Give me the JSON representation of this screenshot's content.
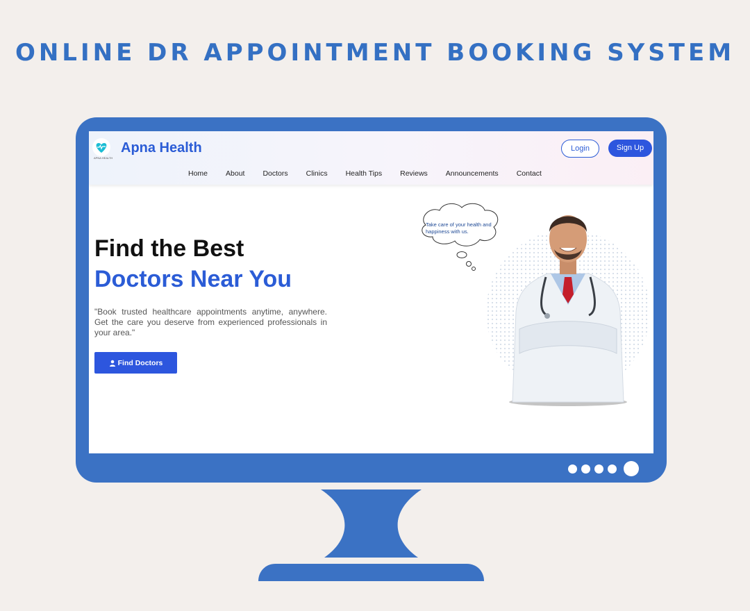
{
  "page": {
    "title": "ONLINE DR APPOINTMENT BOOKING SYSTEM"
  },
  "site": {
    "brand": "Apna Health",
    "logo_text": "APNA HEALTH",
    "login_label": "Login",
    "signup_label": "Sign Up",
    "nav": [
      "Home",
      "About",
      "Doctors",
      "Clinics",
      "Health Tips",
      "Reviews",
      "Announcements",
      "Contact"
    ]
  },
  "hero": {
    "heading_line1": "Find the Best",
    "heading_line2": "Doctors Near You",
    "description": "\"Book trusted healthcare appointments anytime, anywhere. Get the care you deserve from experienced professionals in your area.\"",
    "cta_label": "Find Doctors",
    "bubble_text": "Take care of your health and happiness with us."
  },
  "colors": {
    "accent": "#2d56de",
    "monitor": "#3b72c4",
    "background": "#f3efec"
  },
  "icons": {
    "logo": "heart-pulse-icon",
    "cta": "user-icon"
  }
}
